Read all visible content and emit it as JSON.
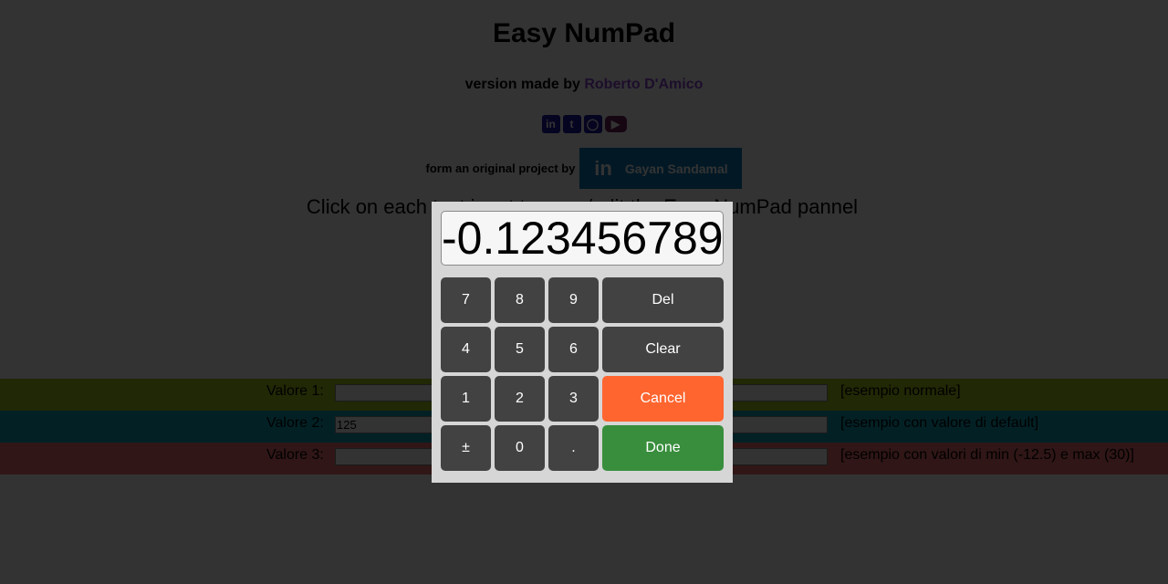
{
  "header": {
    "title": "Easy NumPad",
    "byline_prefix": "version made by",
    "author": "Roberto D'Amico",
    "original_prefix": "form an original project by",
    "original_author": "Gayan Sandamal",
    "instructions": "Click on each text input to open/edit the Easy NumPad pannel"
  },
  "socials": [
    {
      "name": "linkedin-icon",
      "glyph": "in",
      "color": "#1a1aa6"
    },
    {
      "name": "twitter-icon",
      "glyph": "t",
      "color": "#1a1aa6"
    },
    {
      "name": "github-icon",
      "glyph": "◯",
      "color": "#1a1aa6"
    },
    {
      "name": "youtube-icon",
      "glyph": "▶",
      "color": "#6e1f5a"
    }
  ],
  "rows": [
    {
      "label": "Valore 1:",
      "value": "",
      "note": "[esempio normale]",
      "color": "#a5c51a"
    },
    {
      "label": "Valore 2:",
      "value": "125",
      "note": "[esempio con valore di default]",
      "color": "#0fa5b8"
    },
    {
      "label": "Valore 3:",
      "value": "",
      "note": "[esempio con valori di min (-12.5) e max (30)]",
      "color": "#f06e6e"
    }
  ],
  "numpad": {
    "display": "-0.123456789",
    "keys": {
      "k7": "7",
      "k8": "8",
      "k9": "9",
      "del": "Del",
      "k4": "4",
      "k5": "5",
      "k6": "6",
      "clear": "Clear",
      "k1": "1",
      "k2": "2",
      "k3": "3",
      "cancel": "Cancel",
      "sign": "±",
      "k0": "0",
      "dot": ".",
      "done": "Done"
    },
    "colors": {
      "key": "#424242",
      "cancel": "#ff652f",
      "done": "#388e3c"
    }
  }
}
